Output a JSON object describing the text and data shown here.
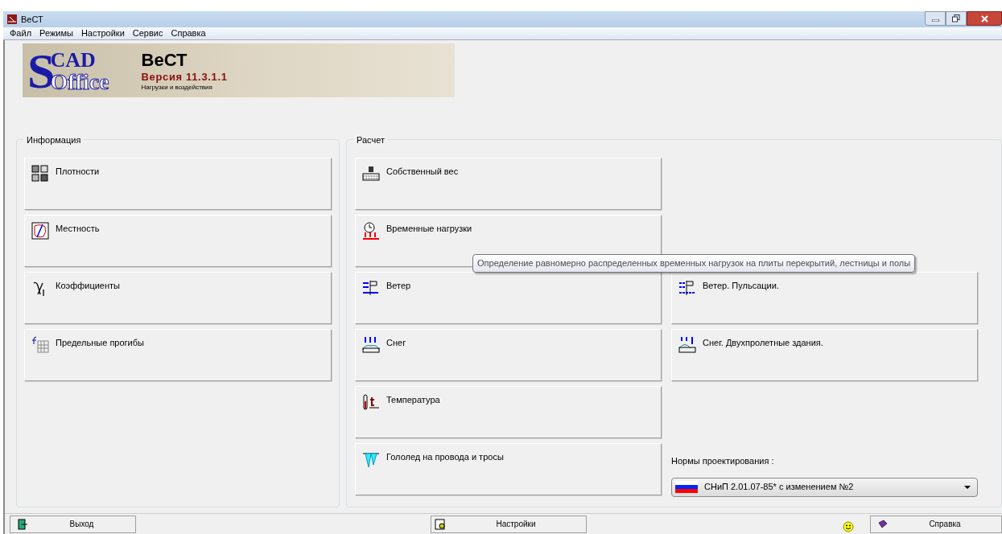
{
  "window": {
    "title": "ВеСТ"
  },
  "menu": [
    "Файл",
    "Режимы",
    "Настройки",
    "Сервис",
    "Справка"
  ],
  "banner": {
    "logo": {
      "initial": "S",
      "top": "CAD",
      "bottom": "Office"
    },
    "title": "ВеСТ",
    "version": "Версия 11.3.1.1",
    "subtitle": "Нагрузки и воздействия"
  },
  "info": {
    "title": "Информация",
    "buttons": [
      "Плотности",
      "Местность",
      "Коэффициенты",
      "Предельные прогибы"
    ]
  },
  "calc": {
    "title": "Расчет",
    "buttons": [
      "Собственный вес",
      "Временные нагрузки",
      "Ветер",
      "Снег",
      "Температура",
      "Гололед на провода и тросы"
    ],
    "extra_buttons": [
      "Ветер. Пульсации.",
      "Снег. Двухпролетные здания."
    ],
    "norms": {
      "label": "Нормы проектирования :",
      "value": "СНиП 2.01.07-85* с изменением №2"
    }
  },
  "tooltip": "Определение равномерно распределенных временных нагрузок на плиты перекрытий, лестницы и полы",
  "footer": {
    "exit": "Выход",
    "settings": "Настройки",
    "help": "Справка"
  }
}
